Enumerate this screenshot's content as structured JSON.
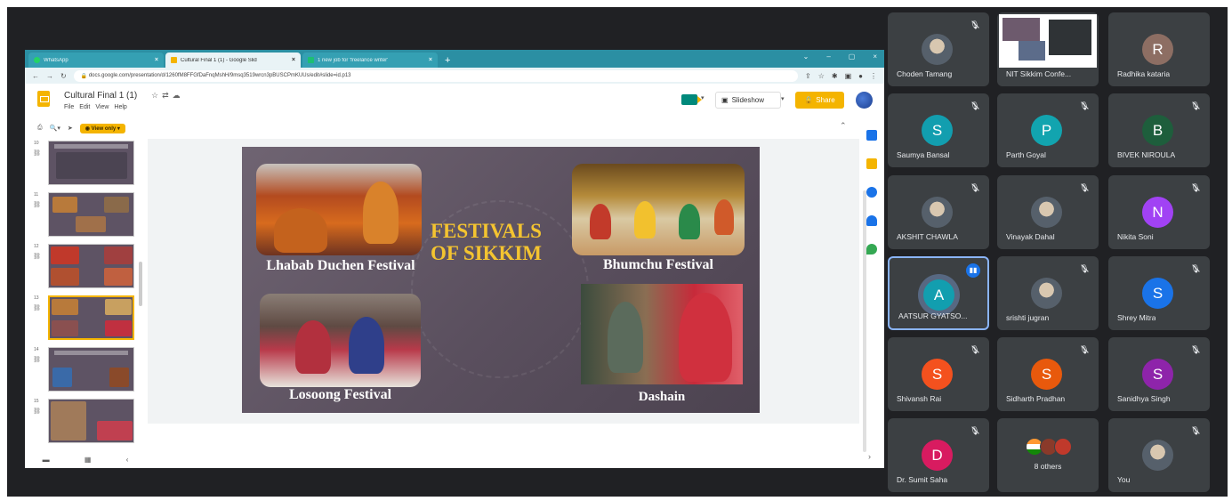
{
  "browser": {
    "tabs": [
      {
        "label": "WhatsApp",
        "icon": "whatsapp-icon"
      },
      {
        "label": "Cultural Final 1 (1) - Google Slid",
        "icon": "slides-icon"
      },
      {
        "label": "1 new job for 'freelance writer'",
        "icon": "jobs-icon"
      }
    ],
    "new_tab": "+",
    "url": "docs.google.com/presentation/d/1260fM8FFGfDaFnqMshH/9msq3519wrcn3pBUSCPmKUUs/edit#slide=id.p13"
  },
  "slides_app": {
    "doc_title": "Cultural Final 1 (1)",
    "menu": [
      "File",
      "Edit",
      "View",
      "Help"
    ],
    "slideshow_label": "Slideshow",
    "share_label": "Share",
    "view_only_label": "View only",
    "thumbnails": [
      {
        "num": "10",
        "title": "CULTURAL DIVERSITY"
      },
      {
        "num": "11",
        "title": ""
      },
      {
        "num": "12",
        "title": ""
      },
      {
        "num": "13",
        "title": "FESTIVALS OF SIKKIM"
      },
      {
        "num": "14",
        "title": "LANGUAGES IN SIKKIM"
      },
      {
        "num": "15",
        "title": ""
      }
    ]
  },
  "slide": {
    "title_line1": "FESTIVALS",
    "title_line2": "OF SIKKIM",
    "captions": [
      "Lhabab Duchen Festival",
      "Bhumchu Festival",
      "Losoong Festival",
      "Dashain"
    ]
  },
  "meet": {
    "participants": [
      {
        "name": "Choden Tamang",
        "initial": "",
        "color": "#56606b",
        "type": "photo",
        "muted": true
      },
      {
        "name": "NIT Sikkim Confe...",
        "initial": "",
        "color": "#ffffff",
        "type": "screen",
        "muted": false
      },
      {
        "name": "Radhika kataria",
        "initial": "R",
        "color": "#8d6e63",
        "type": "letter",
        "muted": false
      },
      {
        "name": "Saumya Bansal",
        "initial": "S",
        "color": "#129eaf",
        "type": "letter",
        "muted": true
      },
      {
        "name": "Parth Goyal",
        "initial": "P",
        "color": "#12a4af",
        "type": "letter",
        "muted": true
      },
      {
        "name": "BIVEK NIROULA",
        "initial": "B",
        "color": "#1e5e3c",
        "type": "letter",
        "muted": true
      },
      {
        "name": "AKSHIT CHAWLA",
        "initial": "",
        "color": "#56606b",
        "type": "photo",
        "muted": true
      },
      {
        "name": "Vinayak Dahal",
        "initial": "",
        "color": "#56606b",
        "type": "photo",
        "muted": true
      },
      {
        "name": "Nikita Soni",
        "initial": "N",
        "color": "#a142f4",
        "type": "letter",
        "muted": true
      },
      {
        "name": "AATSUR GYATSO...",
        "initial": "A",
        "color": "#129eaf",
        "type": "letter",
        "muted": false,
        "speaking": true
      },
      {
        "name": "srishti jugran",
        "initial": "",
        "color": "#e8a0a0",
        "type": "photo",
        "muted": true
      },
      {
        "name": "Shrey Mitra",
        "initial": "S",
        "color": "#1a73e8",
        "type": "letter",
        "muted": true
      },
      {
        "name": "Shivansh Rai",
        "initial": "S",
        "color": "#f4511e",
        "type": "letter",
        "muted": true
      },
      {
        "name": "Sidharth Pradhan",
        "initial": "S",
        "color": "#e8590c",
        "type": "letter",
        "muted": true
      },
      {
        "name": "Sanidhya Singh",
        "initial": "S",
        "color": "#8e24aa",
        "type": "letter",
        "muted": true
      },
      {
        "name": "Dr. Sumit Saha",
        "initial": "D",
        "color": "#d81b60",
        "type": "letter",
        "muted": true
      },
      {
        "name": "8 others",
        "initial": "",
        "color": "#3c4043",
        "type": "others",
        "muted": false
      },
      {
        "name": "You",
        "initial": "",
        "color": "#56606b",
        "type": "photo",
        "muted": true
      }
    ]
  },
  "colors": {
    "accent_yellow": "#f4b400",
    "tab_bar": "#2b8fa3",
    "meet_tile": "#3c4043",
    "meet_bg": "#202124",
    "slide_title": "#f4c430"
  }
}
